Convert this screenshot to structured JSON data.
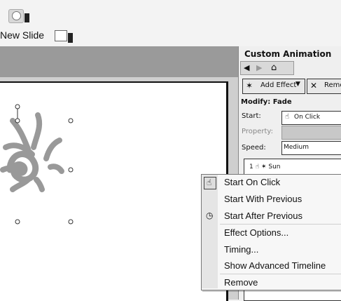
{
  "toolbar": {
    "new_slide_label": "New Slide",
    "help_icon": "help-icon"
  },
  "task_pane": {
    "title": "Custom Animation",
    "buttons": {
      "add_effect": "Add Effect",
      "remove": "Remo"
    },
    "modify": "Modify: Fade",
    "start": {
      "label": "Start:",
      "value": "On Click"
    },
    "property": {
      "label": "Property:",
      "value": ""
    },
    "speed": {
      "label": "Speed:",
      "value": "Medium"
    },
    "animation_list": [
      {
        "index": "1",
        "name": "Sun"
      }
    ]
  },
  "context_menu": {
    "items": [
      {
        "label": "Start On Click",
        "icon": "mouse-click-icon"
      },
      {
        "label": "Start With Previous",
        "icon": ""
      },
      {
        "label": "Start After Previous",
        "icon": "clock-icon"
      },
      {
        "label": "Effect Options...",
        "icon": ""
      },
      {
        "label": "Timing...",
        "icon": ""
      },
      {
        "label": "Show Advanced Timeline",
        "icon": ""
      },
      {
        "label": "Remove",
        "icon": ""
      }
    ]
  },
  "colors": {
    "editor_bar": "#9a9a9a",
    "menu_background": "#f7f7f7"
  }
}
